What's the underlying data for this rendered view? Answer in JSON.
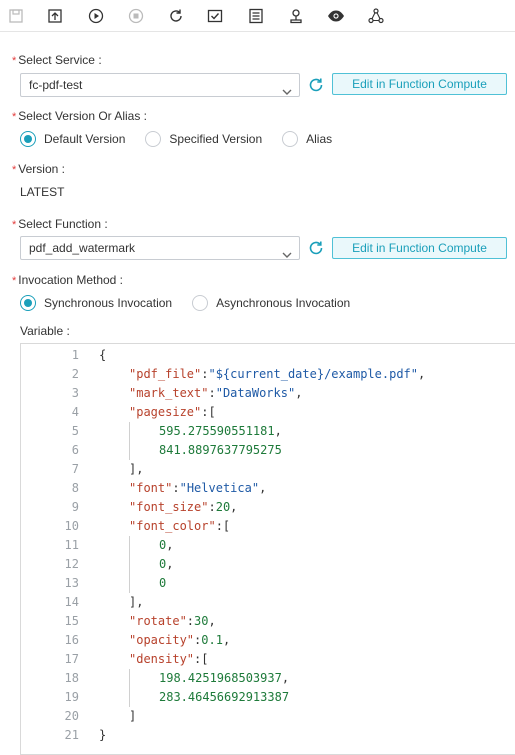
{
  "toolbar": {
    "icons": [
      "save-icon",
      "submit-icon",
      "run-icon",
      "stop-icon",
      "rerun-icon",
      "check-icon",
      "log-icon",
      "owner-icon",
      "preview-icon",
      "dependency-icon"
    ]
  },
  "form": {
    "service": {
      "label": "Select Service :",
      "value": "fc-pdf-test",
      "edit_label": "Edit in Function Compute"
    },
    "version_alias": {
      "label": "Select Version Or Alias :",
      "options": [
        "Default Version",
        "Specified Version",
        "Alias"
      ],
      "selected": "Default Version"
    },
    "version": {
      "label": "Version :",
      "value": "LATEST"
    },
    "function": {
      "label": "Select Function :",
      "value": "pdf_add_watermark",
      "edit_label": "Edit in Function Compute"
    },
    "invocation": {
      "label": "Invocation Method :",
      "options": [
        "Synchronous Invocation",
        "Asynchronous Invocation"
      ],
      "selected": "Synchronous Invocation"
    },
    "variable": {
      "label": "Variable :"
    }
  },
  "editor": {
    "lines": [
      {
        "n": "1",
        "indent": 0,
        "parts": [
          [
            "p",
            "{"
          ]
        ]
      },
      {
        "n": "2",
        "indent": 1,
        "parts": [
          [
            "k",
            "\"pdf_file\""
          ],
          [
            "p",
            ":"
          ],
          [
            "s",
            "\"${current_date}/example.pdf\""
          ],
          [
            "p",
            ","
          ]
        ]
      },
      {
        "n": "3",
        "indent": 1,
        "parts": [
          [
            "k",
            "\"mark_text\""
          ],
          [
            "p",
            ":"
          ],
          [
            "s",
            "\"DataWorks\""
          ],
          [
            "p",
            ","
          ]
        ]
      },
      {
        "n": "4",
        "indent": 1,
        "parts": [
          [
            "k",
            "\"pagesize\""
          ],
          [
            "p",
            ":["
          ]
        ]
      },
      {
        "n": "5",
        "indent": 2,
        "parts": [
          [
            "n",
            "595.275590551181"
          ],
          [
            "p",
            ","
          ]
        ]
      },
      {
        "n": "6",
        "indent": 2,
        "parts": [
          [
            "n",
            "841.8897637795275"
          ]
        ]
      },
      {
        "n": "7",
        "indent": 1,
        "parts": [
          [
            "p",
            "],"
          ]
        ]
      },
      {
        "n": "8",
        "indent": 1,
        "parts": [
          [
            "k",
            "\"font\""
          ],
          [
            "p",
            ":"
          ],
          [
            "s",
            "\"Helvetica\""
          ],
          [
            "p",
            ","
          ]
        ]
      },
      {
        "n": "9",
        "indent": 1,
        "parts": [
          [
            "k",
            "\"font_size\""
          ],
          [
            "p",
            ":"
          ],
          [
            "n",
            "20"
          ],
          [
            "p",
            ","
          ]
        ]
      },
      {
        "n": "10",
        "indent": 1,
        "parts": [
          [
            "k",
            "\"font_color\""
          ],
          [
            "p",
            ":["
          ]
        ]
      },
      {
        "n": "11",
        "indent": 2,
        "parts": [
          [
            "n",
            "0"
          ],
          [
            "p",
            ","
          ]
        ]
      },
      {
        "n": "12",
        "indent": 2,
        "parts": [
          [
            "n",
            "0"
          ],
          [
            "p",
            ","
          ]
        ]
      },
      {
        "n": "13",
        "indent": 2,
        "parts": [
          [
            "n",
            "0"
          ]
        ]
      },
      {
        "n": "14",
        "indent": 1,
        "parts": [
          [
            "p",
            "],"
          ]
        ]
      },
      {
        "n": "15",
        "indent": 1,
        "parts": [
          [
            "k",
            "\"rotate\""
          ],
          [
            "p",
            ":"
          ],
          [
            "n",
            "30"
          ],
          [
            "p",
            ","
          ]
        ]
      },
      {
        "n": "16",
        "indent": 1,
        "parts": [
          [
            "k",
            "\"opacity\""
          ],
          [
            "p",
            ":"
          ],
          [
            "n",
            "0.1"
          ],
          [
            "p",
            ","
          ]
        ]
      },
      {
        "n": "17",
        "indent": 1,
        "parts": [
          [
            "k",
            "\"density\""
          ],
          [
            "p",
            ":["
          ]
        ]
      },
      {
        "n": "18",
        "indent": 2,
        "parts": [
          [
            "n",
            "198.4251968503937"
          ],
          [
            "p",
            ","
          ]
        ]
      },
      {
        "n": "19",
        "indent": 2,
        "parts": [
          [
            "n",
            "283.46456692913387"
          ]
        ]
      },
      {
        "n": "20",
        "indent": 1,
        "parts": [
          [
            "p",
            "]"
          ]
        ]
      },
      {
        "n": "21",
        "indent": 0,
        "parts": [
          [
            "p",
            "}"
          ]
        ]
      }
    ]
  },
  "colors": {
    "accent": "#1a9fba",
    "required": "#e23b3b",
    "json_key": "#b7412b",
    "json_string": "#1f5aa6",
    "json_number": "#1e7a3a"
  }
}
